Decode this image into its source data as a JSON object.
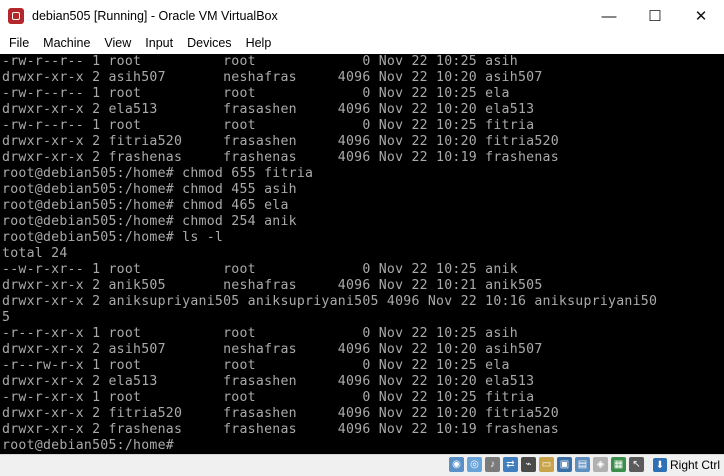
{
  "window": {
    "title": "debian505 [Running] - Oracle VM VirtualBox",
    "minimize_glyph": "—",
    "maximize_glyph": "☐",
    "close_glyph": "✕"
  },
  "menu": [
    "File",
    "Machine",
    "View",
    "Input",
    "Devices",
    "Help"
  ],
  "terminal": {
    "lines": [
      "-rw-r--r-- 1 root          root             0 Nov 22 10:25 asih",
      "drwxr-xr-x 2 asih507       neshafras     4096 Nov 22 10:20 asih507",
      "-rw-r--r-- 1 root          root             0 Nov 22 10:25 ela",
      "drwxr-xr-x 2 ela513        frasashen     4096 Nov 22 10:20 ela513",
      "-rw-r--r-- 1 root          root             0 Nov 22 10:25 fitria",
      "drwxr-xr-x 2 fitria520     frasashen     4096 Nov 22 10:20 fitria520",
      "drwxr-xr-x 2 frashenas     frashenas     4096 Nov 22 10:19 frashenas",
      "root@debian505:/home# chmod 655 fitria",
      "root@debian505:/home# chmod 455 asih",
      "root@debian505:/home# chmod 465 ela",
      "root@debian505:/home# chmod 254 anik",
      "root@debian505:/home# ls -l",
      "total 24",
      "--w-r-xr-- 1 root          root             0 Nov 22 10:25 anik",
      "drwxr-xr-x 2 anik505       neshafras     4096 Nov 22 10:21 anik505",
      "drwxr-xr-x 2 aniksupriyani505 aniksupriyani505 4096 Nov 22 10:16 aniksupriyani50",
      "5",
      "-r--r-xr-x 1 root          root             0 Nov 22 10:25 asih",
      "drwxr-xr-x 2 asih507       neshafras     4096 Nov 22 10:20 asih507",
      "-r--rw-r-x 1 root          root             0 Nov 22 10:25 ela",
      "drwxr-xr-x 2 ela513        frasashen     4096 Nov 22 10:20 ela513",
      "-rw-r-xr-x 1 root          root             0 Nov 22 10:25 fitria",
      "drwxr-xr-x 2 fitria520     frasashen     4096 Nov 22 10:20 fitria520",
      "drwxr-xr-x 2 frashenas     frashenas     4096 Nov 22 10:19 frashenas",
      "root@debian505:/home#"
    ],
    "foreground": "#aaaaaa",
    "background": "#000000"
  },
  "statusbar": {
    "host_key_label": "Right Ctrl",
    "icons": [
      "hard-disk-icon",
      "optical-drive-icon",
      "audio-icon",
      "network-icon",
      "usb-icon",
      "shared-folders-icon",
      "display-icon",
      "video-capture-icon",
      "recording-icon",
      "cpu-icon",
      "mouse-integration-icon"
    ]
  }
}
